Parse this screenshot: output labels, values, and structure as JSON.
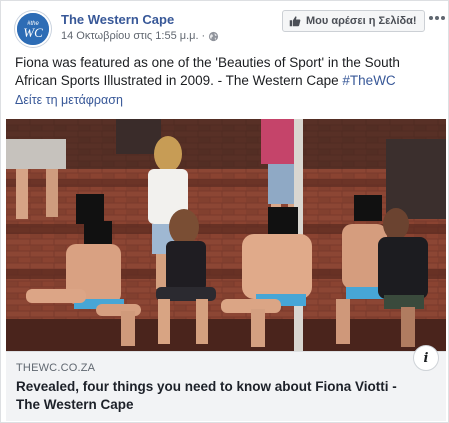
{
  "post": {
    "page_name": "The Western Cape",
    "avatar_text": "WC",
    "avatar_hash": "#the",
    "timestamp": "14 Οκτωβρίου στις 1:55 μ.μ.",
    "separator": "·",
    "privacy_icon": "globe-icon",
    "like_page_label": "Μου αρέσει η Σελίδα!",
    "text_main": "Fiona was featured as one of the 'Beauties of Sport' in the South African Sports Illustrated in 2009. - The Western Cape ",
    "text_hashtag": "#TheWC",
    "see_translation": "Δείτε τη μετάφραση"
  },
  "link": {
    "domain": "THEWC.CO.ZA",
    "title": "Revealed, four things you need to know about Fiona Viotti - The Western Cape",
    "info_label": "i"
  },
  "colors": {
    "link_blue": "#385898",
    "brand_blue": "#2d6cb5",
    "footer_bg": "#f2f3f5"
  }
}
